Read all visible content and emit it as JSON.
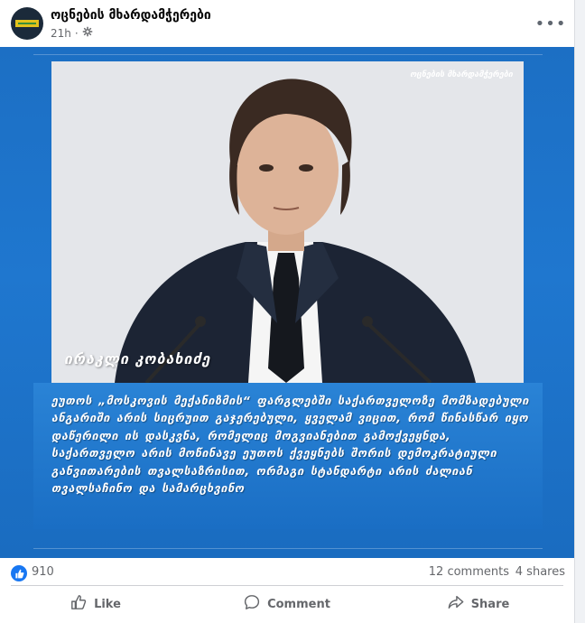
{
  "post": {
    "page_name": "ოცნების მხარდამჭერები",
    "time": "21h",
    "privacy_icon": "gear-icon",
    "more_icon": "more-options-icon"
  },
  "image": {
    "watermark": "ოცნების მხარდამჭერები",
    "name_tag": "ირაკლი კობახიძე",
    "caption": "ეუთოს „მოსკოვის მექანიზმის“ ფარგლებში საქართველოზე მომზადებული ანგარიში არის სიცრუით გაჯერებული, ყველამ ვიცით, რომ წინასწარ იყო დაწერილი ის დასკვნა, რომელიც მოგვიანებით გამოქვეყნდა, საქართველო არის მოწინავე ეუთოს ქვეყნებს შორის დემოკრატიული განვითარების თვალსაზრისით, ორმაგი სტანდარტი არის ძალიან თვალსაჩინო და სამარცხვინო"
  },
  "stats": {
    "reactions": "910",
    "comments": "12 comments",
    "shares": "4 shares"
  },
  "actions": {
    "like": "Like",
    "comment": "Comment",
    "share": "Share"
  },
  "colors": {
    "accent": "#1877f2",
    "image_bg": "#1e73c8"
  }
}
